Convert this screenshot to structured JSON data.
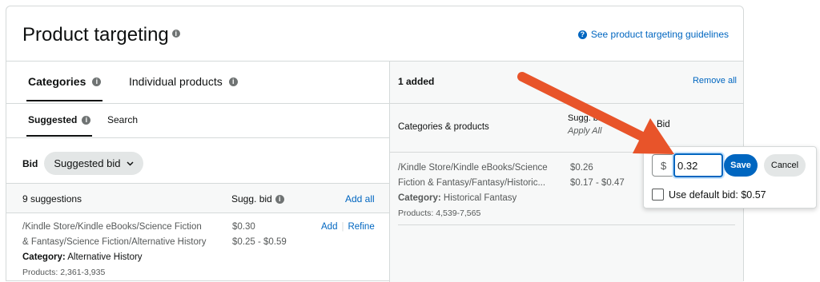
{
  "header": {
    "title": "Product targeting",
    "guidelines_link": "See product targeting guidelines"
  },
  "left": {
    "tabs": [
      {
        "label": "Categories",
        "active": true
      },
      {
        "label": "Individual products",
        "active": false
      }
    ],
    "subtabs": [
      {
        "label": "Suggested",
        "active": true
      },
      {
        "label": "Search",
        "active": false
      }
    ],
    "bid_label": "Bid",
    "bid_dropdown": "Suggested bid",
    "suggestions_header": {
      "count_label": "9 suggestions",
      "sugg_bid_label": "Sugg. bid",
      "add_all": "Add all"
    },
    "rows": [
      {
        "path_line1": "/Kindle Store/Kindle eBooks/Science Fiction",
        "path_line2": "& Fantasy/Science Fiction/Alternative History",
        "category_prefix": "Category:",
        "category": "Alternative History",
        "products": "Products: 2,361-3,935",
        "bid": "$0.30",
        "range": "$0.25 - $0.59",
        "add": "Add",
        "refine": "Refine"
      }
    ]
  },
  "right": {
    "added_label": "1 added",
    "remove_all": "Remove all",
    "col_categories": "Categories & products",
    "col_sugg_bid": "Sugg. bid",
    "col_apply_all": "Apply All",
    "col_bid": "Bid",
    "row": {
      "path_line1": "/Kindle Store/Kindle eBooks/Science",
      "path_line2": "Fiction & Fantasy/Fantasy/Historic...",
      "category_prefix": "Category:",
      "category": "Historical Fantasy",
      "products": "Products: 4,539-7,565",
      "bid": "$0.26",
      "range": "$0.17 - $0.47"
    }
  },
  "popup": {
    "currency": "$",
    "bid_value": "0.32",
    "save": "Save",
    "cancel": "Cancel",
    "use_default": "Use default bid: $0.57"
  },
  "colors": {
    "accent": "#0066c0",
    "arrow": "#e8542a"
  }
}
